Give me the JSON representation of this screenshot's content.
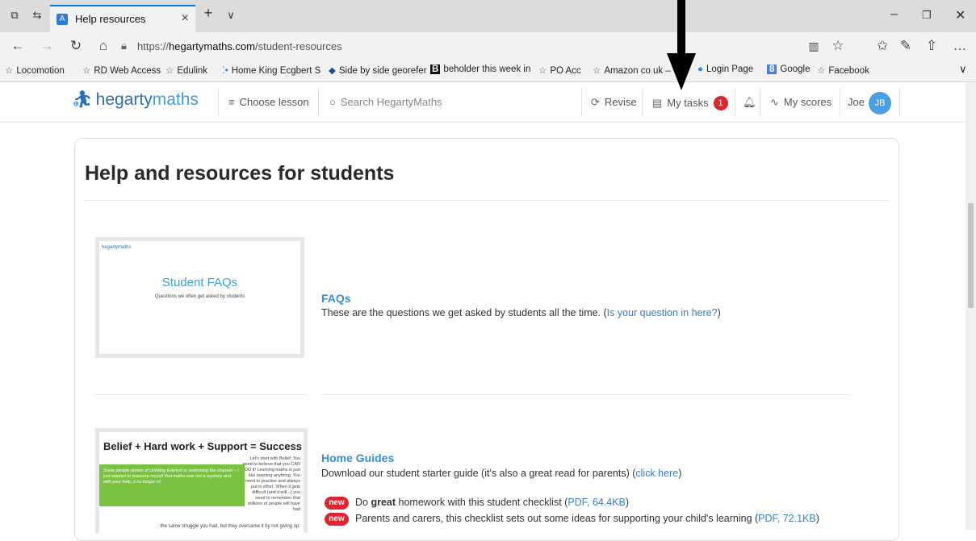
{
  "browser": {
    "tab_title": "Help resources",
    "tab_favicon_letter": "A",
    "url_prefix": "https://",
    "url_domain": "hegartymaths.com",
    "url_path": "/student-resources"
  },
  "favorites": [
    {
      "label": "Locomotion",
      "icon": "star-icon"
    },
    {
      "label": "RD Web Access",
      "icon": "star-icon"
    },
    {
      "label": "Edulink",
      "icon": "star-icon"
    },
    {
      "label": "Home King Ecgbert S",
      "icon": "dots-icon"
    },
    {
      "label": "Side by side georefer",
      "icon": "drop-icon"
    },
    {
      "label": "beholder this week in",
      "icon": "b-icon"
    },
    {
      "label": "PO Acc",
      "icon": "star-icon"
    },
    {
      "label": "Amazon co uk –",
      "icon": "star-icon"
    },
    {
      "label": "Login Page",
      "icon": "edge-icon"
    },
    {
      "label": "Google",
      "icon": "g-icon"
    },
    {
      "label": "Facebook",
      "icon": "star-icon"
    }
  ],
  "site": {
    "logo_prefix": "hegarty",
    "logo_suffix": "maths",
    "nav": {
      "choose_lesson": "Choose lesson",
      "search_placeholder": "Search HegartyMaths",
      "revise": "Revise",
      "my_tasks": "My tasks",
      "my_tasks_count": "1",
      "my_scores": "My scores",
      "user_name": "Joe",
      "user_initials": "JB"
    }
  },
  "main": {
    "title": "Help and resources for students",
    "faq": {
      "thumb_title": "Student FAQs",
      "thumb_sub": "Questions we often get asked by students",
      "title": "FAQs",
      "text": "These are the questions we get asked by students all the time. (",
      "link": "Is your question in here?",
      "text_end": ")"
    },
    "guides": {
      "thumb_title": "Belief + Hard work + Support = Success",
      "thumb_green": "Some people dream of climbing Everest or swimming the channel – I just wanted to reassure myself that maths was not a mystery and, with your help, it no longer is!",
      "thumb_right": "Let's start with Belief: You need to believe that you CAN DO it! Learning maths is just like learning anything. You need to practise and always put in effort. When it gets difficult (and it will...) you need to remember that millions of people will have had",
      "thumb_bottom": "the same struggle you had, but they overcame it by not giving up.",
      "title": "Home Guides",
      "text": "Download our student starter guide (it's also a great read for parents) (",
      "link": "click here",
      "text_end": ")",
      "new_label": "new",
      "item1_pre": "Do ",
      "item1_bold": "great",
      "item1_post": " homework with this student checklist (",
      "item1_link": "PDF, 64.4KB",
      "item1_end": ")",
      "item2_text": "Parents and carers, this checklist sets out some ideas for supporting your child's learning (",
      "item2_link": "PDF, 72.1KB",
      "item2_end": ")"
    }
  }
}
